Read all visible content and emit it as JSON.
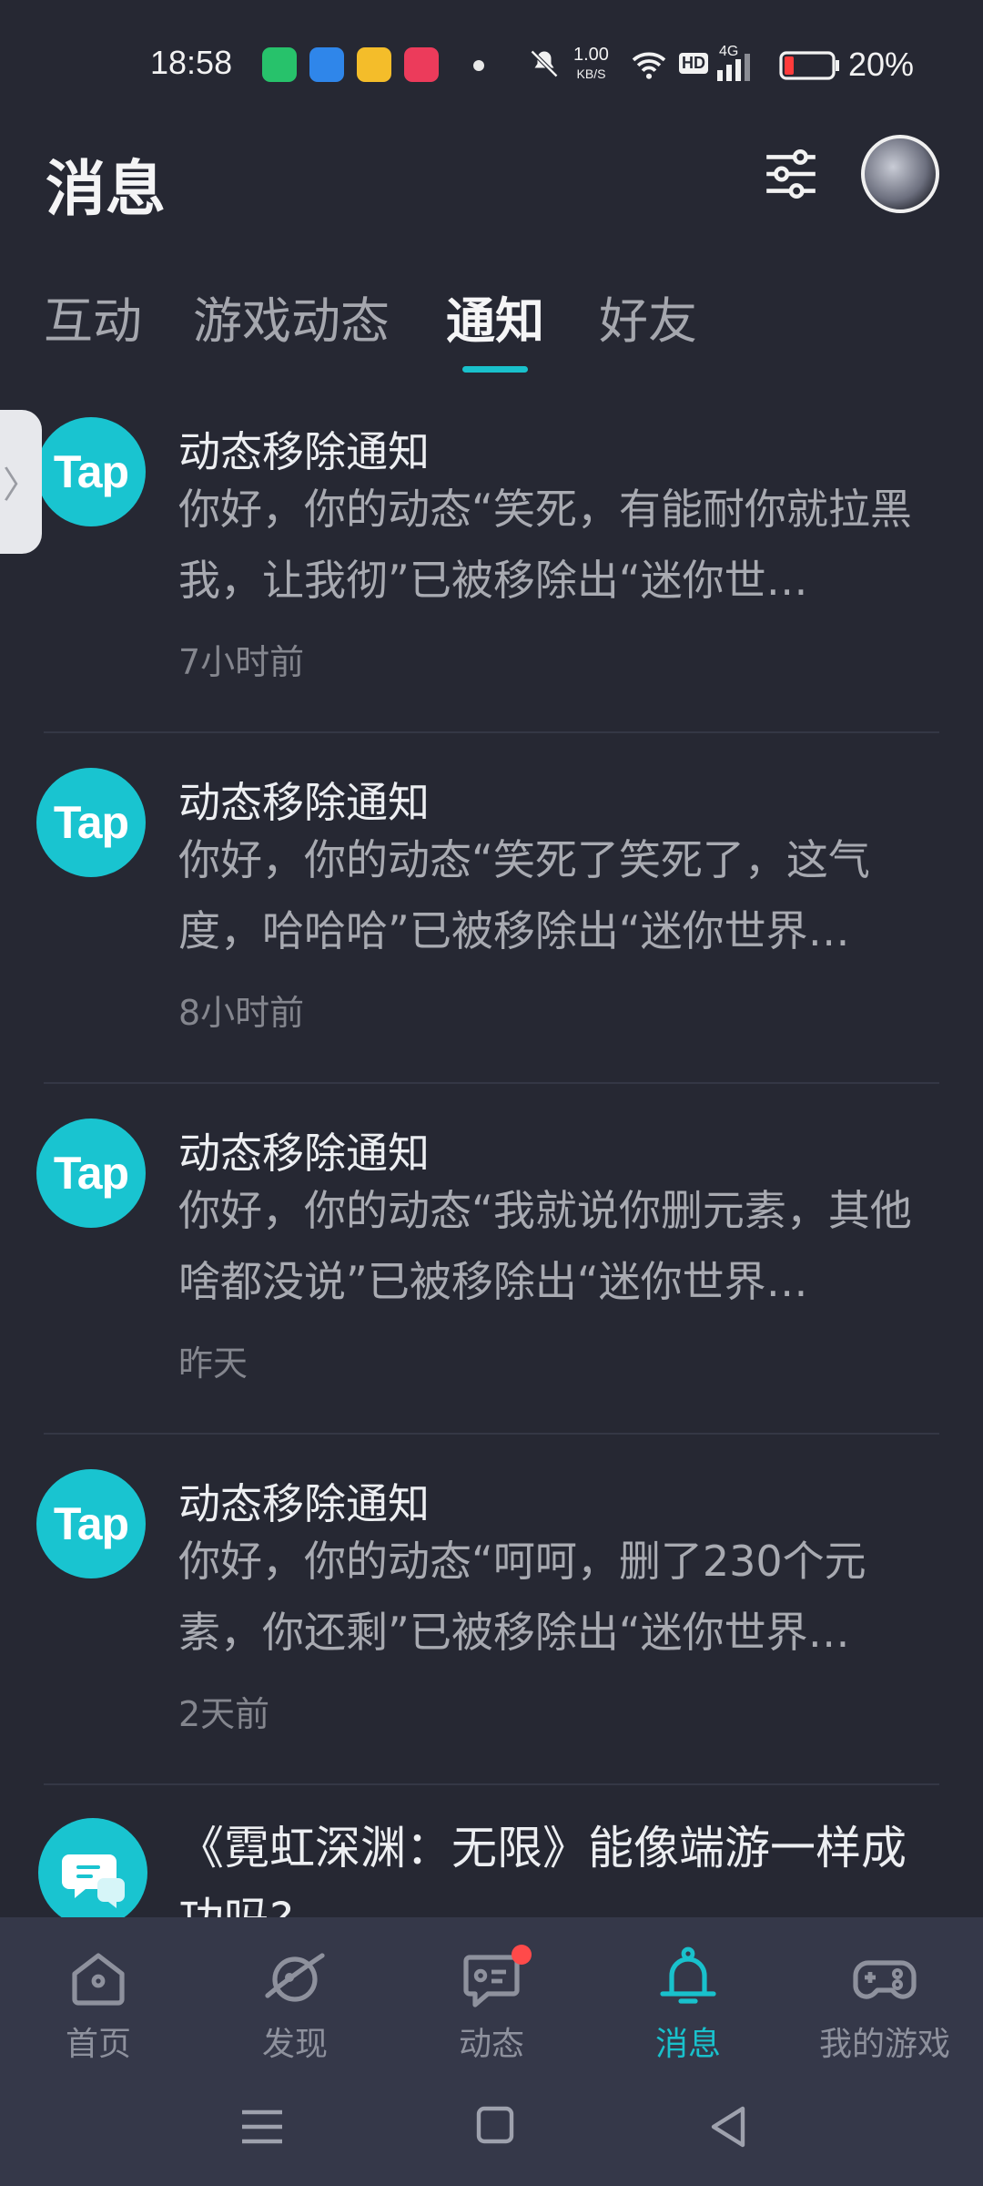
{
  "status_bar": {
    "time": "18:58",
    "net_speed_value": "1.00",
    "net_speed_unit": "KB/S",
    "hd": "HD",
    "network": "4G",
    "battery": "20%",
    "app_icons": [
      "green-app-icon",
      "blue-app-icon",
      "yellow-app-icon",
      "red-app-icon"
    ]
  },
  "header": {
    "title": "消息"
  },
  "tabs": [
    {
      "label": "互动",
      "active": false
    },
    {
      "label": "游戏动态",
      "active": false
    },
    {
      "label": "通知",
      "active": true
    },
    {
      "label": "好友",
      "active": false
    }
  ],
  "notifications": [
    {
      "avatar_text": "Tap",
      "title": "动态移除通知",
      "body": "你好，你的动态“笑死，有能耐你就拉黑我，让我彻”已被移除出“迷你世…",
      "time": "7小时前"
    },
    {
      "avatar_text": "Tap",
      "title": "动态移除通知",
      "body": "你好，你的动态“笑死了笑死了，这气度，哈哈哈”已被移除出“迷你世界…",
      "time": "8小时前"
    },
    {
      "avatar_text": "Tap",
      "title": "动态移除通知",
      "body": "你好，你的动态“我就说你删元素，其他啥都没说”已被移除出“迷你世界…",
      "time": "昨天"
    },
    {
      "avatar_text": "Tap",
      "title": "动态移除通知",
      "body": "你好，你的动态“呵呵，删了230个元素，你还剩”已被移除出“迷你世界…",
      "time": "2天前"
    }
  ],
  "partial_item": {
    "title": "《霓虹深渊：无限》能像端游一样成功吗?"
  },
  "bottom_nav": [
    {
      "label": "首页",
      "icon": "home-icon",
      "active": false
    },
    {
      "label": "发现",
      "icon": "discover-icon",
      "active": false
    },
    {
      "label": "动态",
      "icon": "moments-icon",
      "active": false,
      "badge": true
    },
    {
      "label": "消息",
      "icon": "bell-icon",
      "active": true
    },
    {
      "label": "我的游戏",
      "icon": "gamepad-icon",
      "active": false
    }
  ],
  "colors": {
    "background": "#262833",
    "accent": "#19c1cc",
    "nav_background": "#353849",
    "badge": "#ff4a4a"
  }
}
